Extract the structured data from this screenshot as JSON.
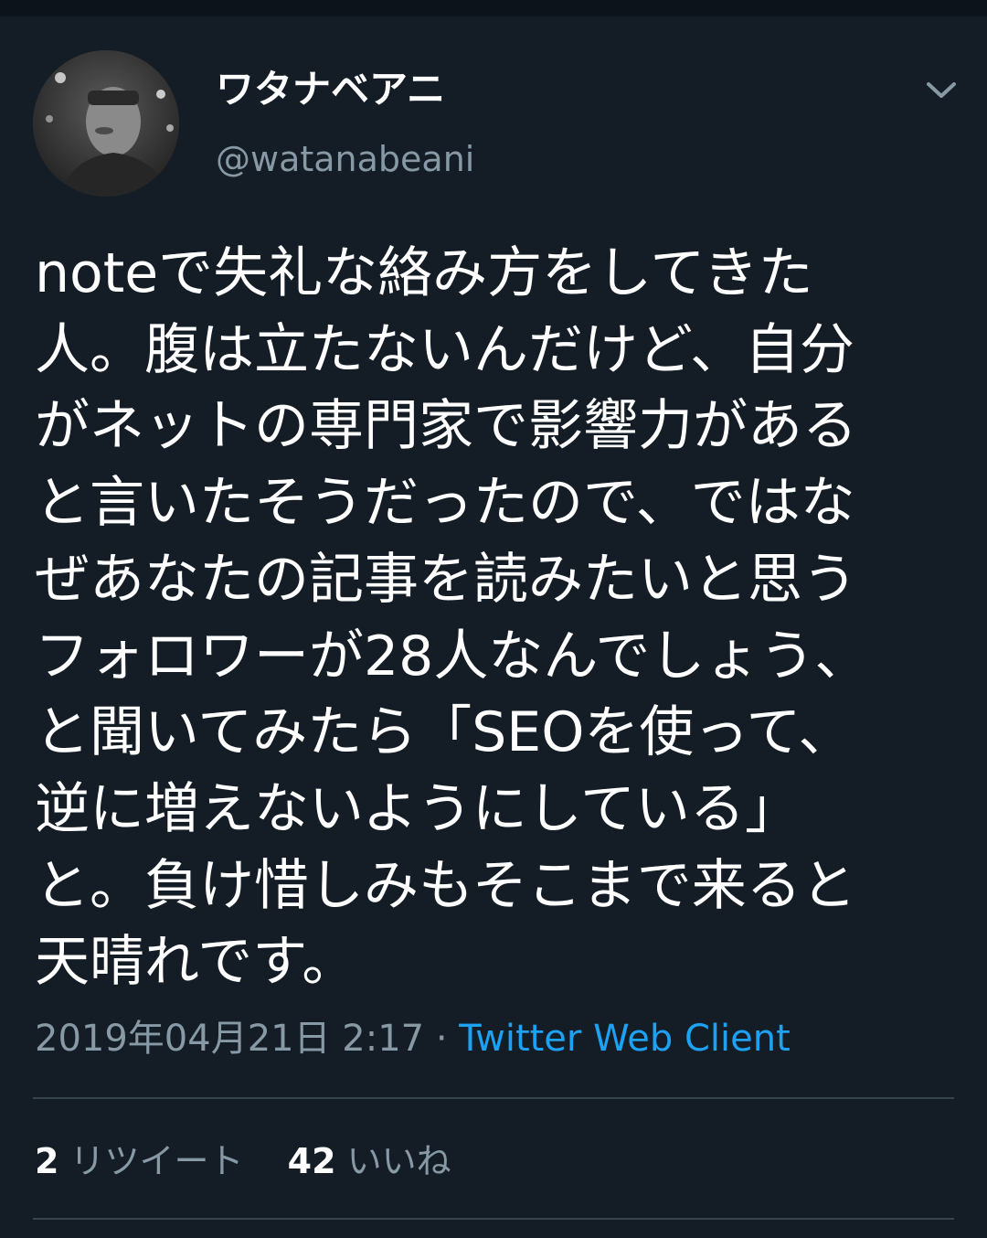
{
  "user": {
    "display_name": "ワタナベアニ",
    "handle": "@watanabeani",
    "avatar_icon": "avatar-photo",
    "menu_icon": "chevron-down-icon"
  },
  "tweet": {
    "lines": [
      "noteで失礼な絡み方をしてきた",
      "人。腹は立たないんだけど、自分",
      "がネットの専門家で影響力がある",
      "と言いたそうだったので、ではな",
      "ぜあなたの記事を読みたいと思う",
      "フォロワーが28人なんでしょう、",
      "と聞いてみたら「SEOを使って、",
      "逆に増えないようにしている」",
      "と。負け惜しみもそこまで来ると",
      "天晴れです。"
    ]
  },
  "meta": {
    "date": "2019年04月21日 2:17",
    "separator": "·",
    "client": "Twitter Web Client"
  },
  "stats": {
    "retweets_count": "2",
    "retweets_label": "リツイート",
    "likes_count": "42",
    "likes_label": "いいね"
  },
  "colors": {
    "background": "#141d26",
    "text_primary": "#ffffff",
    "text_secondary": "#8899a6",
    "link": "#1da1f2",
    "divider": "#38444d"
  }
}
